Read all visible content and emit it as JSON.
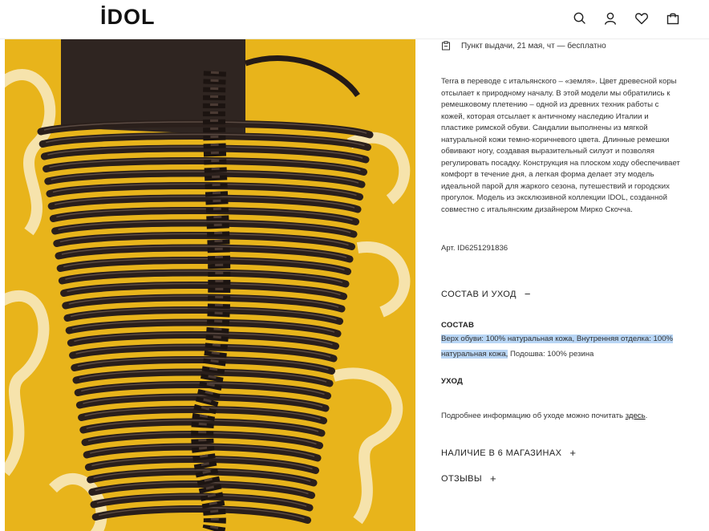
{
  "header": {
    "logo": "İDOL",
    "icons": [
      "search-icon",
      "user-icon",
      "heart-icon",
      "bag-icon"
    ]
  },
  "delivery": {
    "icon": "pickup-point-icon",
    "text": "Пункт выдачи, 21 мая, чт — бесплатно"
  },
  "description": {
    "text": "Terra в переводе с итальянского – «земля». Цвет древесной коры отсылает к природному началу. В этой модели мы обратились к ремешковому плетению – одной из древних техник работы с кожей, которая отсылает к античному наследию Италии и пластике римской обуви. Сандалии выполнены из мягкой натуральной кожи темно-коричневого цвета. Длинные ремешки обвивают ногу, создавая выразительный силуэт и позволяя регулировать посадку. Конструкция на плоском ходу обеспечивает комфорт в течение дня, а легкая форма делает эту модель идеальной парой для жаркого сезона, путешествий и городских прогулок. Модель из эксклюзивной коллекции IDOL, созданной совместно с итальянским дизайнером Мирко Скочча.",
    "article": "Арт. ID6251291836"
  },
  "composition_care": {
    "label": "СОСТАВ И УХОД",
    "sign": "−",
    "composition_title": "СОСТАВ",
    "composition_highlighted": "Верх обуви: 100% натуральная кожа, Внутренняя отделка: 100% натуральная кожа,",
    "composition_rest": " Подошва: 100% резина",
    "care_title": "УХОД",
    "care_text": "Подробнее информацию об уходе можно почитать ",
    "care_link": "здесь",
    "care_end": "."
  },
  "availability": {
    "label": "НАЛИЧИЕ В 6 МАГАЗИНАХ",
    "sign": "+"
  },
  "reviews": {
    "label": "ОТЗЫВЫ",
    "sign": "+"
  },
  "colors": {
    "photo_background": "#e8b41b",
    "leather": "#2a1f1b",
    "highlight": "#b9d6f5"
  }
}
